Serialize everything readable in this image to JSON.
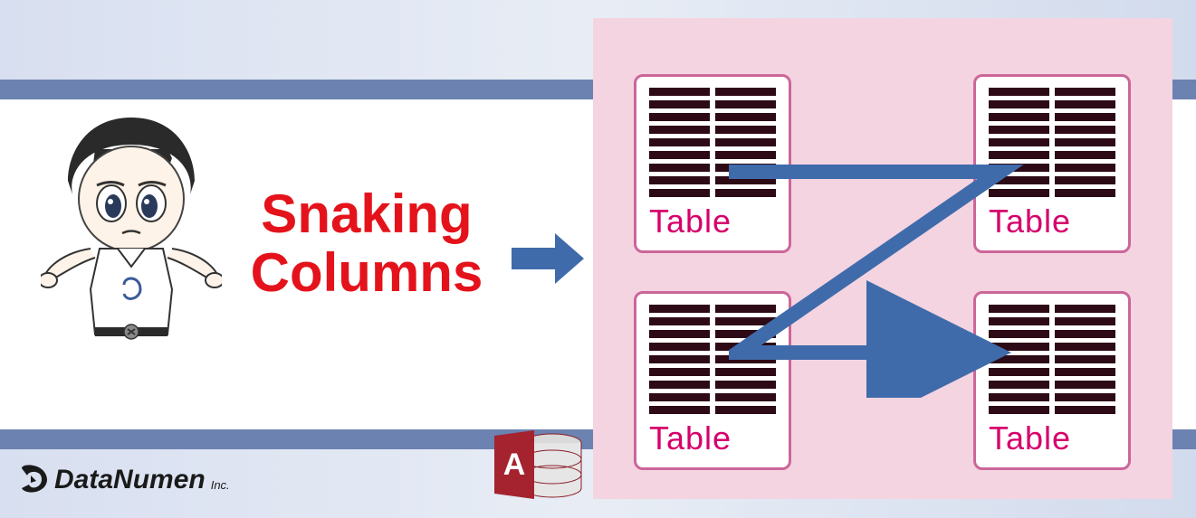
{
  "title": {
    "line1": "Snaking",
    "line2": "Columns"
  },
  "tables": {
    "t1": "Table",
    "t2": "Table",
    "t3": "Table",
    "t4": "Table"
  },
  "logo": {
    "name": "DataNumen",
    "suffix": "Inc."
  },
  "icons": {
    "mascot": "datanumen-mascot-icon",
    "arrow": "arrow-right-icon",
    "zarrow": "z-flow-arrow-icon",
    "access": "ms-access-icon",
    "logoMark": "datanumen-logo-icon"
  },
  "colors": {
    "accent": "#e4131b",
    "pink": "#f4d4e0",
    "magenta": "#d6006c",
    "stripe": "#6c82b0",
    "arrowBlue": "#3f6bab"
  }
}
